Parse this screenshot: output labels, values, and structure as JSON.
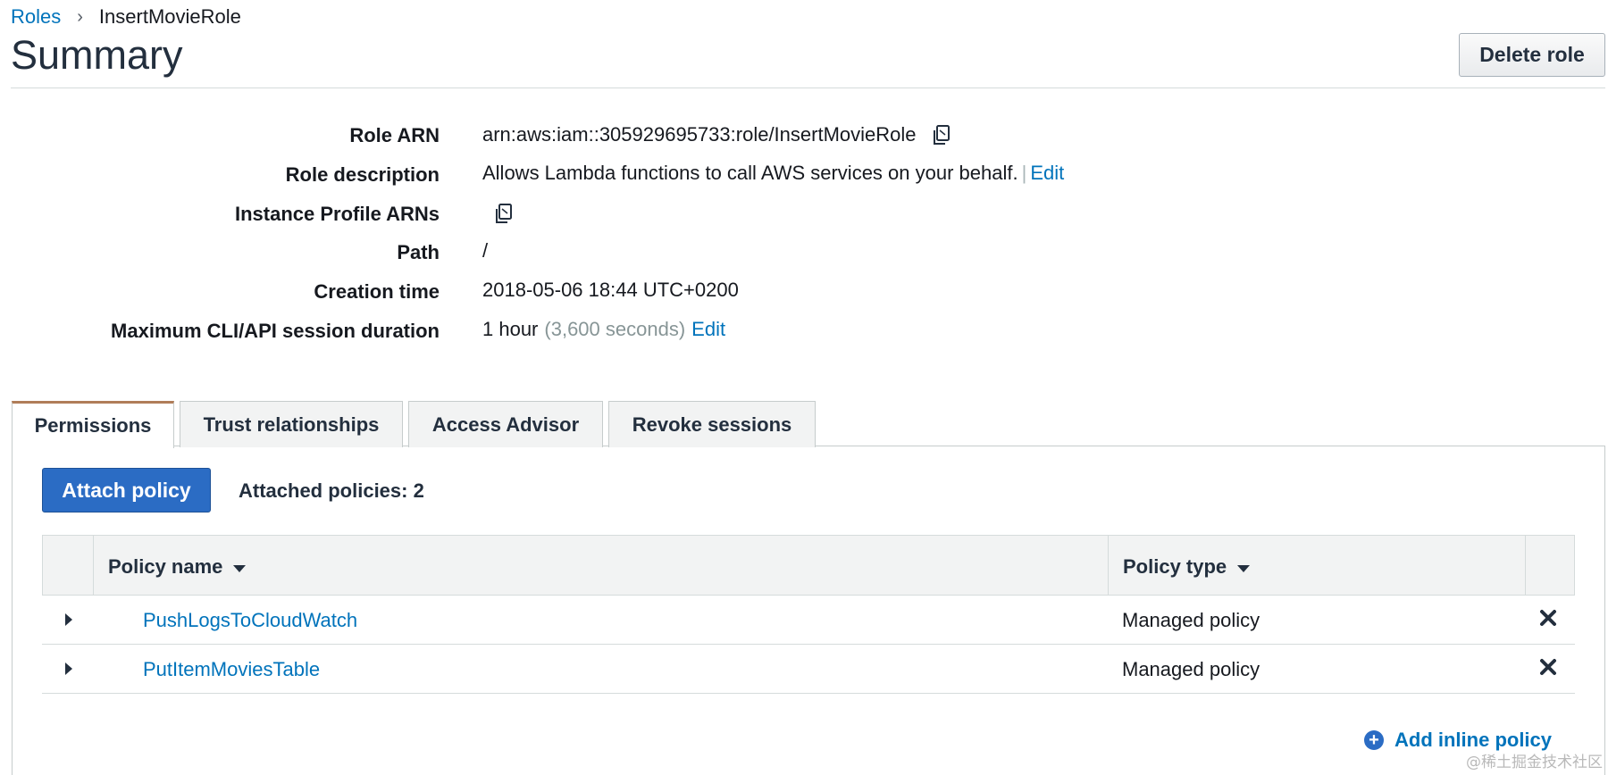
{
  "breadcrumb": {
    "parent": "Roles",
    "separator": "›",
    "current": "InsertMovieRole"
  },
  "header": {
    "title": "Summary",
    "delete_label": "Delete role"
  },
  "summary": {
    "role_arn": {
      "label": "Role ARN",
      "value": "arn:aws:iam::305929695733:role/InsertMovieRole",
      "icon": "copy-icon"
    },
    "role_description": {
      "label": "Role description",
      "value": "Allows Lambda functions to call AWS services on your behalf.",
      "pipe": "|",
      "edit": "Edit"
    },
    "instance_profile": {
      "label": "Instance Profile ARNs",
      "icon": "copy-icon"
    },
    "path": {
      "label": "Path",
      "value": "/"
    },
    "creation_time": {
      "label": "Creation time",
      "value": "2018-05-06 18:44 UTC+0200"
    },
    "session_duration": {
      "label": "Maximum CLI/API session duration",
      "value": "1 hour",
      "seconds": "(3,600 seconds)",
      "edit": "Edit"
    }
  },
  "tabs": [
    {
      "label": "Permissions",
      "active": true
    },
    {
      "label": "Trust relationships",
      "active": false
    },
    {
      "label": "Access Advisor",
      "active": false
    },
    {
      "label": "Revoke sessions",
      "active": false
    }
  ],
  "permissions": {
    "attach_label": "Attach policy",
    "attached_count": "Attached policies: 2",
    "columns": {
      "name": "Policy name",
      "type": "Policy type"
    },
    "policies": [
      {
        "name": "PushLogsToCloudWatch",
        "type": "Managed policy"
      },
      {
        "name": "PutItemMoviesTable",
        "type": "Managed policy"
      }
    ],
    "add_inline_label": "Add inline policy"
  },
  "watermark": "@稀土掘金技术社区",
  "colors": {
    "link": "#0073bb",
    "primary_button": "#2b6cc4",
    "active_tab_accent": "#b07d59",
    "muted_text": "#879596"
  }
}
